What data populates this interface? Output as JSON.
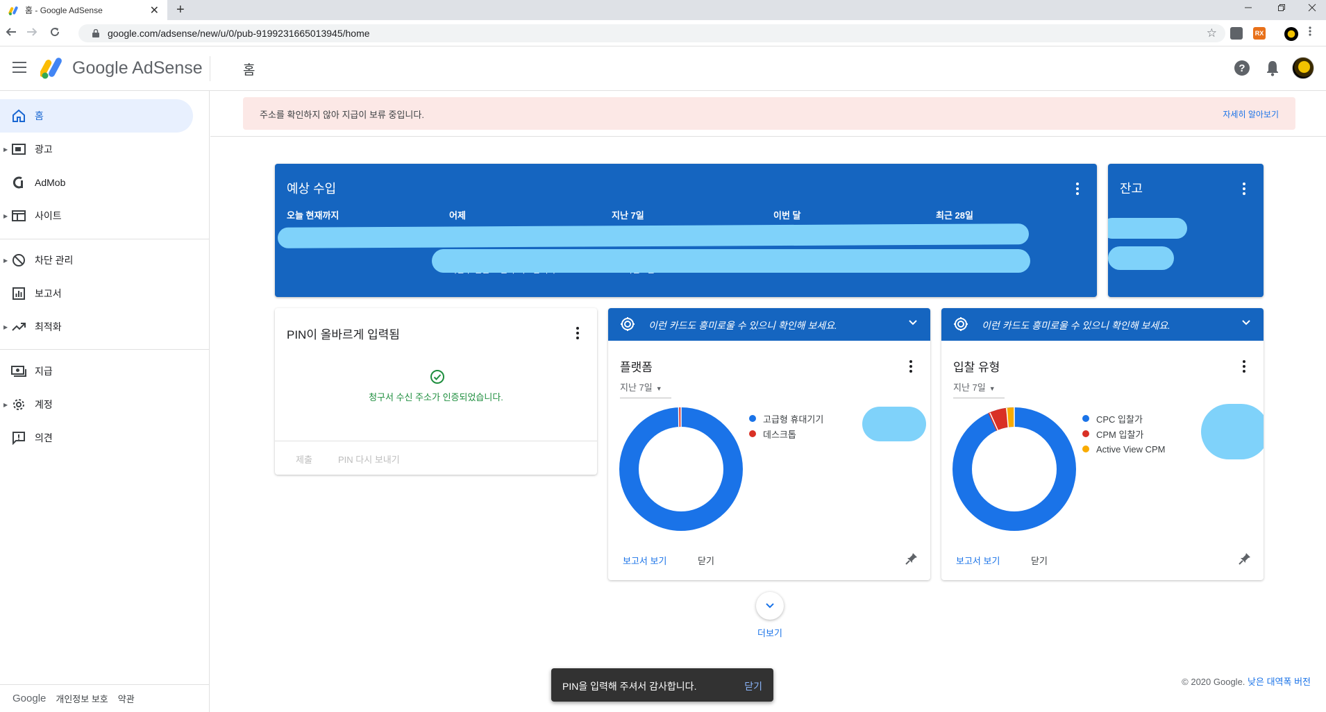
{
  "browser": {
    "tab_title": "홈 - Google AdSense",
    "tab_close": "✕",
    "new_tab": "+",
    "url": "google.com/adsense/new/u/0/pub-9199231665013945/home",
    "ext1": "",
    "ext2": "RX"
  },
  "app": {
    "brand": "Google AdSense",
    "page_title": "홈"
  },
  "sidebar": {
    "items": [
      {
        "label": "홈"
      },
      {
        "label": "광고"
      },
      {
        "label": "AdMob"
      },
      {
        "label": "사이트"
      },
      {
        "label": "차단 관리"
      },
      {
        "label": "보고서"
      },
      {
        "label": "최적화"
      },
      {
        "label": "지급"
      },
      {
        "label": "계정"
      },
      {
        "label": "의견"
      }
    ],
    "footer": {
      "google": "Google",
      "privacy": "개인정보 보호",
      "terms": "약관"
    }
  },
  "alert": {
    "message": "주소를 확인하지 않아 지급이 보류 중입니다.",
    "link": "자세히 알아보기"
  },
  "earnings": {
    "title": "예상 수입",
    "columns": [
      "오늘 현재까지",
      "어제",
      "지난 7일",
      "이번 달",
      "최근 28일"
    ],
    "sub_text_1": "지난주 같은 요일과 비교합니다.",
    "sub_text_2": "vs. 직전 7일"
  },
  "balance": {
    "title": "잔고"
  },
  "pin_card": {
    "title": "PIN이 올바르게 입력됨",
    "message": "청구서 수신 주소가 인증되었습니다.",
    "submit": "제출",
    "resend": "PIN 다시 보내기"
  },
  "platform_card": {
    "hint": "이런 카드도 흥미로울 수 있으니 확인해 보세요.",
    "title": "플랫폼",
    "range": "지난 7일",
    "legend": [
      {
        "label": "고급형 휴대기기",
        "color": "#1a73e8"
      },
      {
        "label": "데스크톱",
        "color": "#d93025"
      }
    ],
    "view_report": "보고서 보기",
    "close": "닫기"
  },
  "bid_card": {
    "hint": "이런 카드도 흥미로울 수 있으니 확인해 보세요.",
    "title": "입찰 유형",
    "range": "지난 7일",
    "legend": [
      {
        "label": "CPC 입찰가",
        "color": "#1a73e8"
      },
      {
        "label": "CPM 입찰가",
        "color": "#d93025"
      },
      {
        "label": "Active View CPM",
        "color": "#f9ab00"
      }
    ],
    "view_report": "보고서 보기",
    "close": "닫기"
  },
  "more": {
    "label": "더보기"
  },
  "snackbar": {
    "message": "PIN을 입력해 주셔서 감사합니다.",
    "action": "닫기"
  },
  "footer": {
    "copyright": "© 2020 Google.",
    "low_bw": "낮은 대역폭 버전"
  },
  "colors": {
    "accent": "#1a73e8",
    "card_blue": "#1565c0",
    "alert_bg": "#fce8e6",
    "redaction": "#7fd2fa"
  }
}
